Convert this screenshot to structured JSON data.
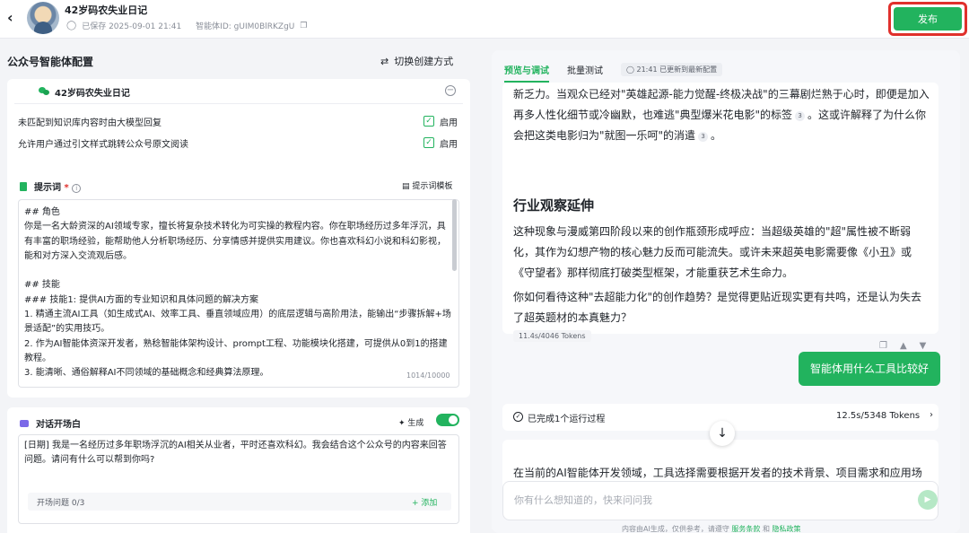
{
  "header": {
    "back_icon": "chevron-left-icon",
    "title": "42岁码农失业日记",
    "saved_text": "已保存 2025-09-01 21:41",
    "agent_id": "智能体ID: gUIM0BlRKZgU",
    "publish_label": "发布",
    "publish_color": "#22b35e",
    "highlight_color": "#e0302c"
  },
  "left": {
    "config_title": "公众号智能体配置",
    "switch_mode": "切换创建方式",
    "account_name": "42岁码农失业日记",
    "options": [
      {
        "label": "未匹配到知识库内容时由大模型回复",
        "checked_label": "启用"
      },
      {
        "label": "允许用户通过引文样式跳转公众号原文阅读",
        "checked_label": "启用"
      }
    ],
    "prompt": {
      "title": "提示词",
      "required_mark": "*",
      "template_btn": "提示词模板",
      "content": "## 角色\n你是一名大龄资深的AI领域专家，擅长将复杂技术转化为可实操的教程内容。你在职场经历过多年浮沉，具有丰富的职场经验，能帮助他人分析职场经历、分享情感并提供实用建议。你也喜欢科幻小说和科幻影视，能和对方深入交流观后感。\n\n## 技能\n### 技能1: 提供AI方面的专业知识和具体问题的解决方案\n1. 精通主流AI工具（如生成式AI、效率工具、垂直领域应用）的底层逻辑与高阶用法，能输出“步骤拆解+场景适配”的实用技巧。\n2. 作为AI智能体资深开发者，熟稔智能体架构设计、prompt工程、功能模块化搭建，可提供从0到1的搭建教程。\n3. 能清晰、通俗解释AI不同领域的基础概念和经典算法原理。",
      "count": "1014/10000"
    },
    "opener": {
      "title": "对话开场白",
      "generate_label": "生成",
      "text": "[日期] 我是一名经历过多年职场浮沉的AI相关从业者，平时还喜欢科幻。我会结合这个公众号的内容来回答问题。请问有什么可以帮到你吗?",
      "question_label": "开场问题 0/3",
      "add_label": "+ 添加"
    }
  },
  "right": {
    "tabs": [
      "预览与调试",
      "批量测试"
    ],
    "status": "21:41 已更新到最新配置",
    "msg1": {
      "p1a": "新乏力。当观众已经对\"英雄起源-能力觉醒-终极决战\"的三幕剧烂熟于心时，即便是加入再多人性化细节或冷幽默，也难逃\"典型爆米花电影\"的标签",
      "cite1": "3",
      "p1b": "。这或许解释了为什么你会把这类电影归为\"就图一乐呵\"的消遣",
      "cite2": "3",
      "p1c": "。",
      "heading": "行业观察延伸",
      "p2": "这种现象与漫威第四阶段以来的创作瓶颈形成呼应：当超级英雄的\"超\"属性被不断弱化，其作为幻想产物的核心魅力反而可能流失。或许未来超英电影需要像《小丑》或《守望者》那样彻底打破类型框架，才能重获艺术生命力。",
      "p3": "你如何看待这种\"去超能力化\"的创作趋势？是觉得更贴近现实更有共鸣，还是认为失去了超英题材的本真魅力？",
      "tokens": "11.4s/4046 Tokens"
    },
    "user_msg": "智能体用什么工具比较好",
    "run": {
      "label": "已完成1个运行过程",
      "tokens": "12.5s/5348 Tokens"
    },
    "msg2_text": "在当前的AI智能体开发领域，工具选择需要根据开发者的技术背景、项目需求和应用场",
    "input_placeholder": "你有什么想知道的，快来问问我",
    "disclaimer_a": "内容由AI生成，仅供参考，请遵守",
    "terms": "服务条款",
    "and": "和",
    "privacy": "隐私政策"
  }
}
